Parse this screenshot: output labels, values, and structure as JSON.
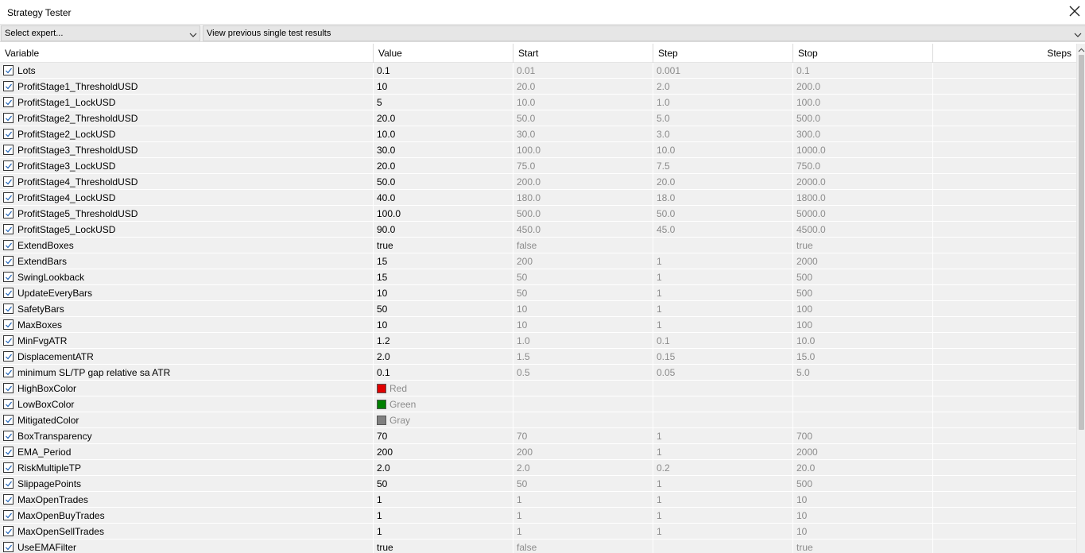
{
  "window": {
    "title": "Strategy Tester"
  },
  "toolbar": {
    "expert_select": "Select expert...",
    "results_select": "View previous single test results"
  },
  "columns": [
    "Variable",
    "Value",
    "Start",
    "Step",
    "Stop",
    "Steps"
  ],
  "colors": {
    "Red": "#e00000",
    "Green": "#008000",
    "Gray": "#808080"
  },
  "rows": [
    {
      "variable": "Lots",
      "value": "0.1",
      "start": "0.01",
      "step": "0.001",
      "stop": "0.1"
    },
    {
      "variable": "ProfitStage1_ThresholdUSD",
      "value": "10",
      "start": "20.0",
      "step": "2.0",
      "stop": "200.0"
    },
    {
      "variable": "ProfitStage1_LockUSD",
      "value": "5",
      "start": "10.0",
      "step": "1.0",
      "stop": "100.0"
    },
    {
      "variable": "ProfitStage2_ThresholdUSD",
      "value": "20.0",
      "start": "50.0",
      "step": "5.0",
      "stop": "500.0"
    },
    {
      "variable": "ProfitStage2_LockUSD",
      "value": "10.0",
      "start": "30.0",
      "step": "3.0",
      "stop": "300.0"
    },
    {
      "variable": "ProfitStage3_ThresholdUSD",
      "value": "30.0",
      "start": "100.0",
      "step": "10.0",
      "stop": "1000.0"
    },
    {
      "variable": "ProfitStage3_LockUSD",
      "value": "20.0",
      "start": "75.0",
      "step": "7.5",
      "stop": "750.0"
    },
    {
      "variable": "ProfitStage4_ThresholdUSD",
      "value": "50.0",
      "start": "200.0",
      "step": "20.0",
      "stop": "2000.0"
    },
    {
      "variable": "ProfitStage4_LockUSD",
      "value": "40.0",
      "start": "180.0",
      "step": "18.0",
      "stop": "1800.0"
    },
    {
      "variable": "ProfitStage5_ThresholdUSD",
      "value": "100.0",
      "start": "500.0",
      "step": "50.0",
      "stop": "5000.0"
    },
    {
      "variable": "ProfitStage5_LockUSD",
      "value": "90.0",
      "start": "450.0",
      "step": "45.0",
      "stop": "4500.0"
    },
    {
      "variable": "ExtendBoxes",
      "value": "true",
      "start": "false",
      "step": "",
      "stop": "true"
    },
    {
      "variable": "ExtendBars",
      "value": "15",
      "start": "200",
      "step": "1",
      "stop": "2000"
    },
    {
      "variable": "SwingLookback",
      "value": "15",
      "start": "50",
      "step": "1",
      "stop": "500"
    },
    {
      "variable": "UpdateEveryBars",
      "value": "10",
      "start": "50",
      "step": "1",
      "stop": "500"
    },
    {
      "variable": "SafetyBars",
      "value": "50",
      "start": "10",
      "step": "1",
      "stop": "100"
    },
    {
      "variable": "MaxBoxes",
      "value": "10",
      "start": "10",
      "step": "1",
      "stop": "100"
    },
    {
      "variable": "MinFvgATR",
      "value": "1.2",
      "start": "1.0",
      "step": "0.1",
      "stop": "10.0"
    },
    {
      "variable": "DisplacementATR",
      "value": "2.0",
      "start": "1.5",
      "step": "0.15",
      "stop": "15.0"
    },
    {
      "variable": "minimum SL/TP gap relative sa ATR",
      "value": "0.1",
      "start": "0.5",
      "step": "0.05",
      "stop": "5.0"
    },
    {
      "variable": "HighBoxColor",
      "value": "",
      "color": "Red",
      "start": "",
      "step": "",
      "stop": ""
    },
    {
      "variable": "LowBoxColor",
      "value": "",
      "color": "Green",
      "start": "",
      "step": "",
      "stop": ""
    },
    {
      "variable": "MitigatedColor",
      "value": "",
      "color": "Gray",
      "start": "",
      "step": "",
      "stop": ""
    },
    {
      "variable": "BoxTransparency",
      "value": "70",
      "start": "70",
      "step": "1",
      "stop": "700"
    },
    {
      "variable": "EMA_Period",
      "value": "200",
      "start": "200",
      "step": "1",
      "stop": "2000"
    },
    {
      "variable": "RiskMultipleTP",
      "value": "2.0",
      "start": "2.0",
      "step": "0.2",
      "stop": "20.0"
    },
    {
      "variable": "SlippagePoints",
      "value": "50",
      "start": "50",
      "step": "1",
      "stop": "500"
    },
    {
      "variable": "MaxOpenTrades",
      "value": "1",
      "start": "1",
      "step": "1",
      "stop": "10"
    },
    {
      "variable": "MaxOpenBuyTrades",
      "value": "1",
      "start": "1",
      "step": "1",
      "stop": "10"
    },
    {
      "variable": "MaxOpenSellTrades",
      "value": "1",
      "start": "1",
      "step": "1",
      "stop": "10"
    },
    {
      "variable": "UseEMAFilter",
      "value": "true",
      "start": "false",
      "step": "",
      "stop": "true"
    }
  ]
}
